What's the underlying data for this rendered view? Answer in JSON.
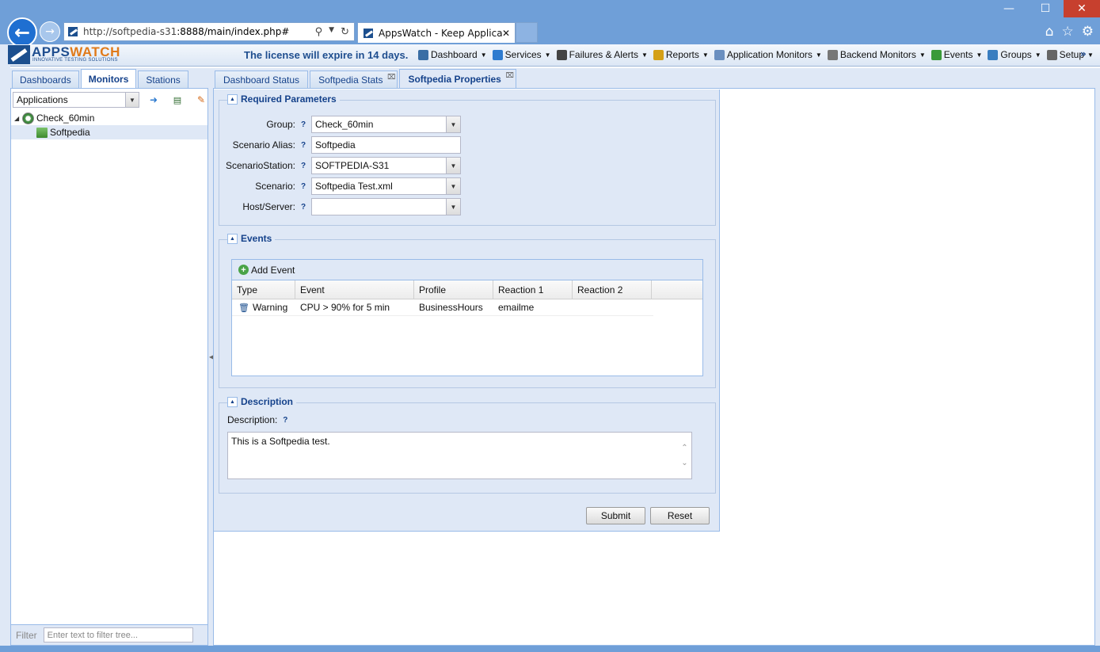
{
  "browser": {
    "url_host": "http://softpedia-s31",
    "url_rest": ":8888/main/index.php#",
    "tab_title": "AppsWatch - Keep Applicat...",
    "window_controls": [
      "—",
      "☐",
      "✕"
    ]
  },
  "app": {
    "logo_main": "APPS",
    "logo_accent": "WATCH",
    "logo_tagline": "INNOVATIVE TESTING SOLUTIONS",
    "license": "The license will expire in 14 days."
  },
  "menu": [
    {
      "label": "Dashboard",
      "icon": "dashboard-icon",
      "color": "#3a6ea5"
    },
    {
      "label": "Services",
      "icon": "services-icon",
      "color": "#2e7bcf"
    },
    {
      "label": "Failures & Alerts",
      "icon": "warning-icon",
      "color": "#444444"
    },
    {
      "label": "Reports",
      "icon": "reports-icon",
      "color": "#d4a017"
    },
    {
      "label": "Application Monitors",
      "icon": "app-monitors-icon",
      "color": "#6a8fc0"
    },
    {
      "label": "Backend Monitors",
      "icon": "backend-monitors-icon",
      "color": "#777777"
    },
    {
      "label": "Events",
      "icon": "events-icon",
      "color": "#3a9a3a"
    },
    {
      "label": "Groups",
      "icon": "groups-icon",
      "color": "#3a7ec0"
    },
    {
      "label": "Setup",
      "icon": "setup-gear-icon",
      "color": "#666666"
    }
  ],
  "left": {
    "tabs": [
      "Dashboards",
      "Monitors",
      "Stations"
    ],
    "active_tab": "Monitors",
    "combo_value": "Applications",
    "tree": [
      {
        "label": "Check_60min",
        "level": 0
      },
      {
        "label": "Softpedia",
        "level": 1
      }
    ],
    "filter_label": "Filter",
    "filter_placeholder": "Enter text to filter tree..."
  },
  "right": {
    "tabs": [
      "Dashboard Status",
      "Softpedia Stats",
      "Softpedia Properties"
    ],
    "active_tab": "Softpedia Properties"
  },
  "form": {
    "required_title": "Required Parameters",
    "fields": [
      {
        "label": "Group:",
        "value": "Check_60min",
        "type": "combo"
      },
      {
        "label": "Scenario Alias:",
        "value": "Softpedia",
        "type": "text"
      },
      {
        "label": "ScenarioStation:",
        "value": "SOFTPEDIA-S31",
        "type": "combo"
      },
      {
        "label": "Scenario:",
        "value": "Softpedia Test.xml",
        "type": "combo"
      },
      {
        "label": "Host/Server:",
        "value": "",
        "type": "combo"
      }
    ],
    "help_mark": "?",
    "events_title": "Events",
    "add_event": "Add Event",
    "columns": [
      "Type",
      "Event",
      "Profile",
      "Reaction 1",
      "Reaction 2"
    ],
    "rows": [
      {
        "type": "Warning",
        "event": "CPU > 90% for 5 min",
        "profile": "BusinessHours",
        "reaction1": "emailme",
        "reaction2": ""
      }
    ],
    "description_title": "Description",
    "description_label": "Description:",
    "description_value": "This is a Softpedia test.",
    "submit": "Submit",
    "reset": "Reset"
  }
}
